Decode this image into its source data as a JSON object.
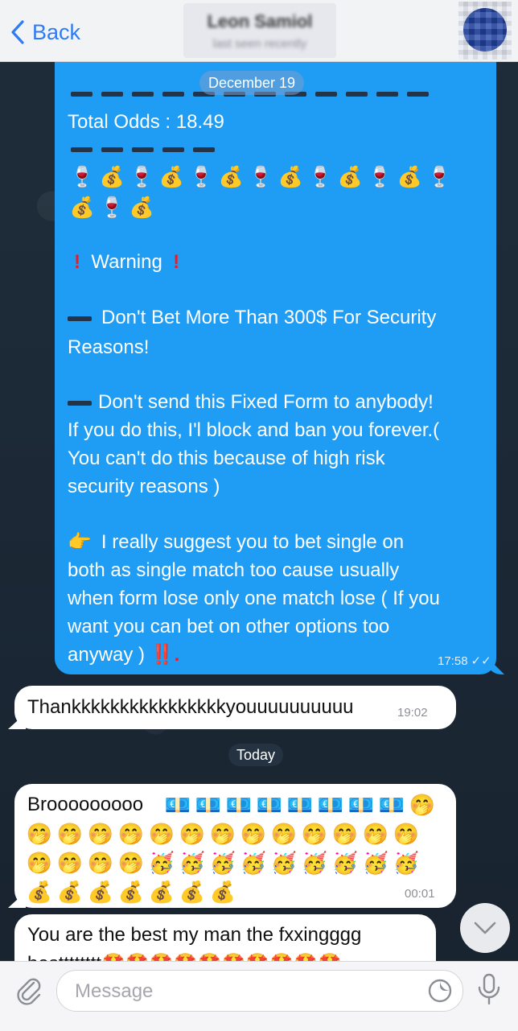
{
  "header": {
    "back_label": "Back",
    "contact_name": "Leon Samiol",
    "contact_status": "last seen recently"
  },
  "outgoing": {
    "date_separator": "December 19",
    "total_odds": "Total Odds : 18.49",
    "warning_label": "Warning",
    "warn1_line1": "Don't Bet More Than 300$ For Security",
    "warn1_line2": "Reasons!",
    "warn2_line1": "Don't send this Fixed Form to anybody!",
    "warn2_line2": "If you do this, I'l block and ban you forever.(",
    "warn2_line3": "You can't do this because of high risk",
    "warn2_line4": "security reasons )",
    "sugg_line1": "I really suggest you to bet single on",
    "sugg_line2": "both as single match too cause usually",
    "sugg_line3": "when form lose only one match lose ( If you",
    "sugg_line4": "want you can bet on other options too",
    "sugg_line5": "anyway )",
    "sugg_end": "‼️.",
    "time": "17:58",
    "read_icon": "double-check-icon"
  },
  "incoming": {
    "msg1_text": "Thankkkkkkkkkkkkkkkkyouuuuuuuuuu",
    "msg1_time": "19:02",
    "today_separator": "Today",
    "msg2_text": "Brooooooooo",
    "msg2_time": "00:01",
    "msg3_line1": "You are the best my man the fxxingggg",
    "msg3_line2": "bestttttttt"
  },
  "composer": {
    "placeholder": "Message"
  },
  "colors": {
    "outgoing_bubble": "#1f9cf4",
    "incoming_bubble": "#ffffff",
    "accent": "#2e7bf6"
  }
}
